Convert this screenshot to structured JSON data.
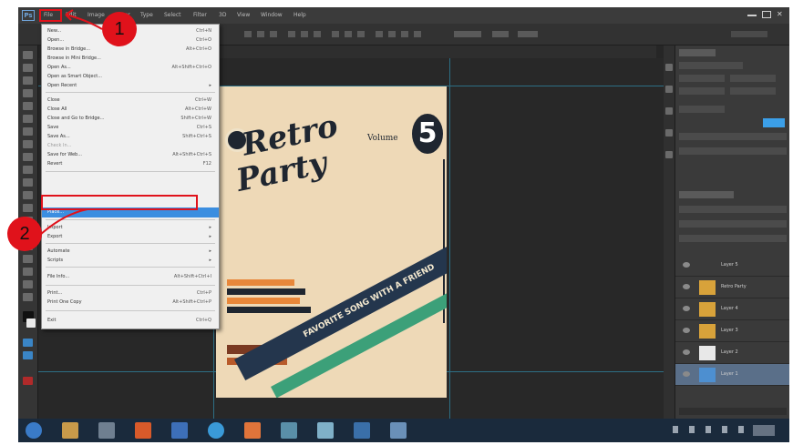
{
  "app": {
    "logo": "Ps",
    "menus": [
      "File",
      "Edit",
      "Image",
      "Layer",
      "Type",
      "Select",
      "Filter",
      "3D",
      "View",
      "Window",
      "Help"
    ]
  },
  "file_menu": {
    "items": [
      {
        "label": "New...",
        "shortcut": "Ctrl+N"
      },
      {
        "label": "Open...",
        "shortcut": "Ctrl+O"
      },
      {
        "label": "Browse in Bridge...",
        "shortcut": "Alt+Ctrl+O"
      },
      {
        "label": "Browse in Mini Bridge...",
        "shortcut": ""
      },
      {
        "label": "Open As...",
        "shortcut": "Alt+Shift+Ctrl+O"
      },
      {
        "label": "Open as Smart Object...",
        "shortcut": ""
      },
      {
        "label": "Open Recent",
        "shortcut": "▸"
      },
      {
        "label": "Close",
        "shortcut": "Ctrl+W"
      },
      {
        "label": "Close All",
        "shortcut": "Alt+Ctrl+W"
      },
      {
        "label": "Close and Go to Bridge...",
        "shortcut": "Shift+Ctrl+W"
      },
      {
        "label": "Save",
        "shortcut": "Ctrl+S"
      },
      {
        "label": "Save As...",
        "shortcut": "Shift+Ctrl+S"
      },
      {
        "label": "Check In...",
        "shortcut": ""
      },
      {
        "label": "Save for Web...",
        "shortcut": "Alt+Shift+Ctrl+S"
      },
      {
        "label": "Revert",
        "shortcut": "F12"
      },
      {
        "label": "Place...",
        "shortcut": ""
      },
      {
        "label": "Import",
        "shortcut": "▸"
      },
      {
        "label": "Export",
        "shortcut": "▸"
      },
      {
        "label": "Automate",
        "shortcut": "▸"
      },
      {
        "label": "Scripts",
        "shortcut": "▸"
      },
      {
        "label": "File Info...",
        "shortcut": "Alt+Shift+Ctrl+I"
      },
      {
        "label": "Print...",
        "shortcut": "Ctrl+P"
      },
      {
        "label": "Print One Copy",
        "shortcut": "Alt+Shift+Ctrl+P"
      },
      {
        "label": "Exit",
        "shortcut": "Ctrl+Q"
      }
    ],
    "highlighted_index": 15
  },
  "poster": {
    "title_line1": "Retro",
    "title_line2": "Party",
    "volume_label": "Volume",
    "volume_number": "5",
    "banner_text": "FAVORITE SONG WITH A FRIEND"
  },
  "layers": {
    "items": [
      "Layer 5",
      "Retro Party",
      "Layer 4",
      "Layer 3",
      "Layer 2",
      "Layer 1"
    ],
    "selected_index": 5
  },
  "callouts": {
    "step1": "1",
    "step2": "2"
  },
  "colors": {
    "highlight": "#3b8ee0",
    "annotation": "#e0121b",
    "poster_bg": "#eed9b7",
    "poster_dark": "#1f2630",
    "banner_green": "#3ca079",
    "stripe_orange": "#e8873a"
  }
}
